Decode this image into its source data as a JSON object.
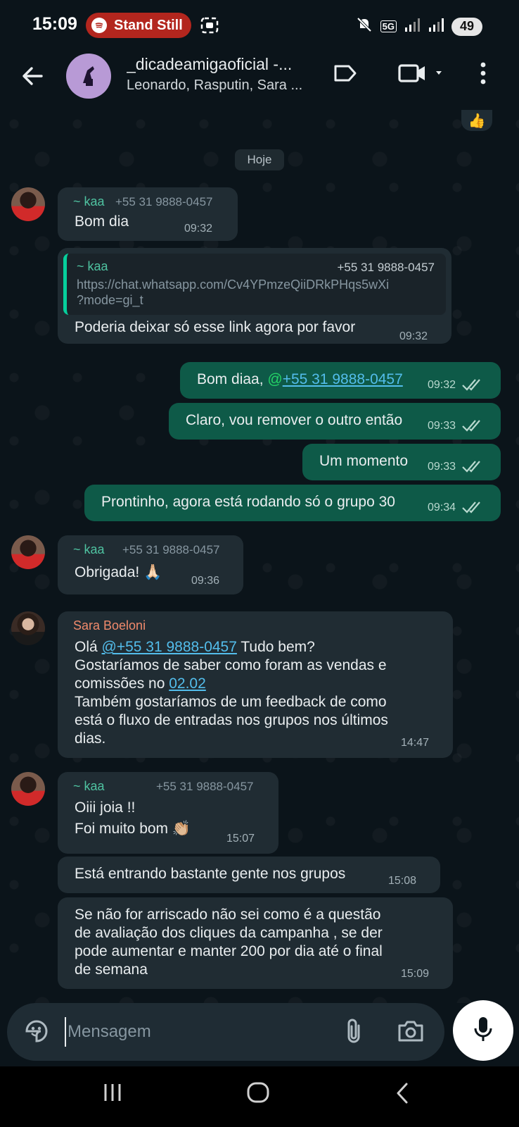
{
  "status_bar": {
    "time": "15:09",
    "now_playing": "Stand Still",
    "network": "5G",
    "battery": "49"
  },
  "header": {
    "title": "_dicadeamigaoficial -...",
    "subtitle": "Leonardo, Rasputin, Sara ..."
  },
  "chat": {
    "top_reaction": "👍",
    "date_chip": "Hoje",
    "messages": [
      {
        "sender": "~ kaa",
        "phone": "+55 31 9888-0457",
        "text": "Bom dia",
        "time": "09:32"
      },
      {
        "quote_sender": "~ kaa",
        "quote_phone": "+55 31 9888-0457",
        "quote_line1": "https://chat.whatsapp.com/Cv4YPmzeQiiDRkPHqs5wXi",
        "quote_line2": "?mode=gi_t",
        "text": "Poderia deixar só esse link agora por favor",
        "time": "09:32"
      },
      {
        "text_prefix": "Bom diaa, ",
        "at": "@",
        "mention": "+55 31 9888-0457",
        "time": "09:32"
      },
      {
        "text": "Claro, vou remover o outro então",
        "time": "09:33"
      },
      {
        "text": "Um momento",
        "time": "09:33"
      },
      {
        "text": "Prontinho, agora está rodando só o grupo 30",
        "time": "09:34"
      },
      {
        "sender": "~ kaa",
        "phone": "+55 31 9888-0457",
        "text": "Obrigada! 🙏🏻",
        "time": "09:36"
      },
      {
        "sender": "Sara Boeloni",
        "text_prefix": "Olá ",
        "mention": "@+55 31 9888-0457",
        "text_suffix": " Tudo bem?",
        "line2": "Gostaríamos de saber como foram as vendas e",
        "line3_prefix": "comissões no ",
        "line3_link": "02.02",
        "line4": "Também gostaríamos de um feedback de como",
        "line5": "está o fluxo de entradas nos grupos nos últimos",
        "line6": "dias.",
        "time": "14:47"
      },
      {
        "sender": "~ kaa",
        "phone": "+55 31 9888-0457",
        "line1": "Oiii joia !!",
        "line2": "Foi muito bom 👏🏼",
        "time": "15:07"
      },
      {
        "text": "Está entrando bastante gente nos grupos",
        "time": "15:08"
      },
      {
        "line1": "Se não for arriscado não sei como é a questão",
        "line2": "de avaliação dos cliques da campanha , se der",
        "line3": "pode aumentar e manter 200 por dia até o final",
        "line4": "de semana",
        "time": "15:09"
      }
    ]
  },
  "input": {
    "placeholder": "Mensagem"
  },
  "colors": {
    "background": "#0b141a",
    "incoming_bubble": "#202c33",
    "outgoing_bubble": "#0e5a48",
    "mention": "#53bdeb",
    "accent_green": "#25d366",
    "now_playing_pill": "#b3261e"
  },
  "icons": {
    "back": "arrow-left-icon",
    "label": "label-tag-icon",
    "video": "video-camera-icon",
    "more": "more-vertical-icon",
    "sticker": "sticker-icon",
    "attach": "paperclip-icon",
    "camera": "camera-icon",
    "mic": "microphone-icon",
    "read": "double-check-icon"
  }
}
